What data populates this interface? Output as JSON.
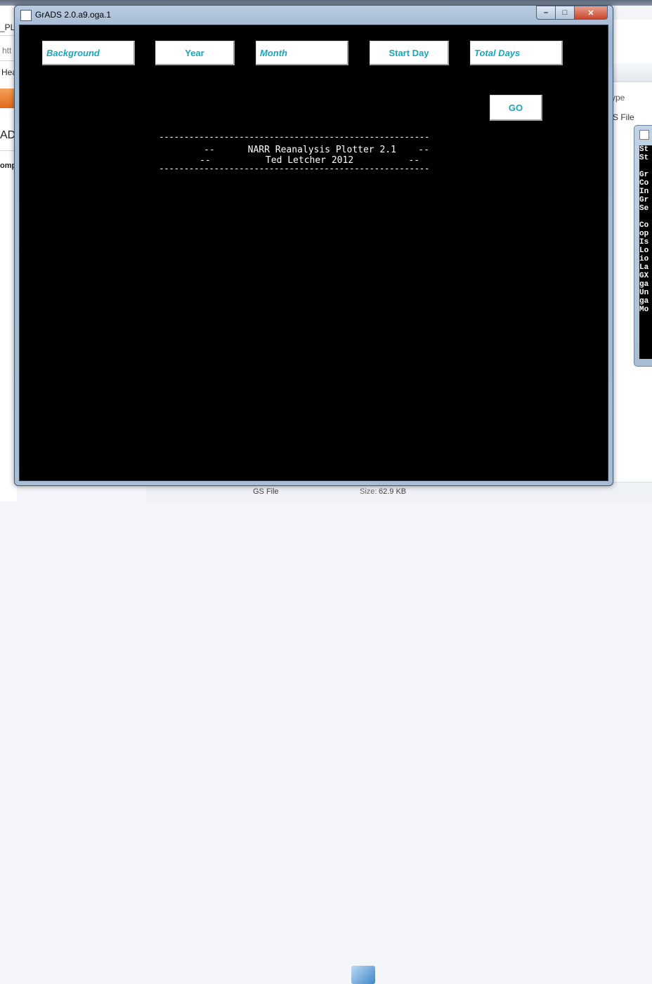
{
  "background": {
    "left_fragments": [
      "_PLC",
      "htt",
      "Hea",
      "AD",
      "omp"
    ],
    "right_fragments": [
      "ype",
      "S File"
    ],
    "bottom": {
      "file_type": "GS File",
      "size_label": "Size:",
      "size_value": "62.9 KB"
    },
    "console_lines": [
      "St",
      "St",
      "",
      "Gr",
      "Co",
      "In",
      "Gr",
      "Se",
      "",
      "Co",
      "op",
      "Is",
      "Lo",
      "io",
      "La",
      "GX",
      "ga",
      "Un",
      "ga",
      "Mo"
    ]
  },
  "window": {
    "title": "GrADS 2.0.a9.oga.1",
    "controls": {
      "minimize": "–",
      "maximize": "□",
      "close": "✕"
    }
  },
  "toolbar": {
    "background_label": "Background",
    "year_label": "Year",
    "month_label": "Month",
    "start_day_label": "Start Day",
    "total_days_label": "Total Days",
    "go_label": "GO"
  },
  "banner": {
    "rule_top": "------------------------------------------------------",
    "line1": "--      NARR Reanalysis Plotter 2.1    --",
    "line2": "--          Ted Letcher 2012          --",
    "rule_bottom": "------------------------------------------------------"
  },
  "colors": {
    "button_text": "#1aa6b8",
    "canvas": "#000000",
    "title_bar": "#b9cbe0"
  }
}
